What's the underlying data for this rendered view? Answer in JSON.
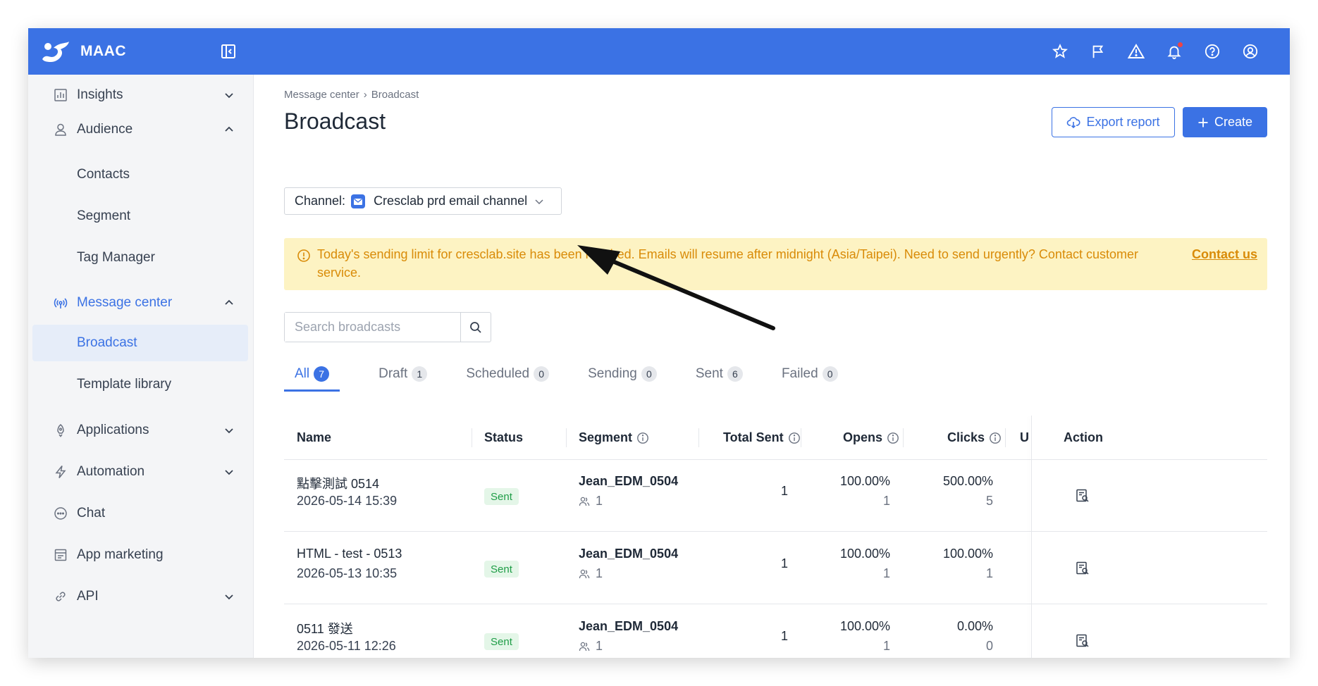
{
  "app": {
    "name": "MAAC"
  },
  "sidebar": {
    "items": [
      {
        "label": "Insights",
        "icon": "chart-icon",
        "expand": "down"
      },
      {
        "label": "Audience",
        "icon": "person-icon",
        "expand": "up"
      },
      {
        "label": "Contacts"
      },
      {
        "label": "Segment"
      },
      {
        "label": "Tag Manager"
      },
      {
        "label": "Message center",
        "icon": "broadcast-icon",
        "expand": "up"
      },
      {
        "label": "Broadcast"
      },
      {
        "label": "Template library"
      },
      {
        "label": "Applications",
        "icon": "rocket-icon",
        "expand": "down"
      },
      {
        "label": "Automation",
        "icon": "bolt-icon",
        "expand": "down"
      },
      {
        "label": "Chat",
        "icon": "chat-icon"
      },
      {
        "label": "App marketing",
        "icon": "app-icon"
      },
      {
        "label": "API",
        "icon": "link-icon",
        "expand": "down"
      }
    ]
  },
  "breadcrumb": {
    "parent": "Message center",
    "sep": "›",
    "current": "Broadcast"
  },
  "page": {
    "title": "Broadcast"
  },
  "actions": {
    "export_label": "Export report",
    "create_label": "Create"
  },
  "channel": {
    "prefix": "Channel:",
    "value": "Cresclab prd email channel"
  },
  "alert": {
    "text": "Today's sending limit for cresclab.site has been reached. Emails will resume after midnight (Asia/Taipei). Need to send urgently? Contact customer service.",
    "link": "Contact us"
  },
  "search": {
    "placeholder": "Search broadcasts"
  },
  "tabs": [
    {
      "label": "All",
      "count": "7"
    },
    {
      "label": "Draft",
      "count": "1"
    },
    {
      "label": "Scheduled",
      "count": "0"
    },
    {
      "label": "Sending",
      "count": "0"
    },
    {
      "label": "Sent",
      "count": "6"
    },
    {
      "label": "Failed",
      "count": "0"
    }
  ],
  "table": {
    "headers": {
      "name": "Name",
      "status": "Status",
      "segment": "Segment",
      "total_sent": "Total Sent",
      "opens": "Opens",
      "clicks": "Clicks",
      "u": "U",
      "action": "Action"
    },
    "rows": [
      {
        "name": "點擊測試 0514",
        "date": "2026-05-14 15:39",
        "status": "Sent",
        "segment": "Jean_EDM_0504",
        "segment_count": "1",
        "total_sent": "1",
        "opens_rate": "100.00%",
        "opens_count": "1",
        "clicks_rate": "500.00%",
        "clicks_count": "5"
      },
      {
        "name": "HTML - test - 0513",
        "date": "2026-05-13 10:35",
        "status": "Sent",
        "segment": "Jean_EDM_0504",
        "segment_count": "1",
        "total_sent": "1",
        "opens_rate": "100.00%",
        "opens_count": "1",
        "clicks_rate": "100.00%",
        "clicks_count": "1"
      },
      {
        "name": "0511 發送",
        "date": "2026-05-11 12:26",
        "status": "Sent",
        "segment": "Jean_EDM_0504",
        "segment_count": "1",
        "total_sent": "1",
        "opens_rate": "100.00%",
        "opens_count": "1",
        "clicks_rate": "0.00%",
        "clicks_count": "0"
      }
    ]
  },
  "colors": {
    "brand": "#3b72e4",
    "alert_bg": "#fdf3c3",
    "alert_text": "#d98b08",
    "sent_badge": "#1f9d47"
  }
}
